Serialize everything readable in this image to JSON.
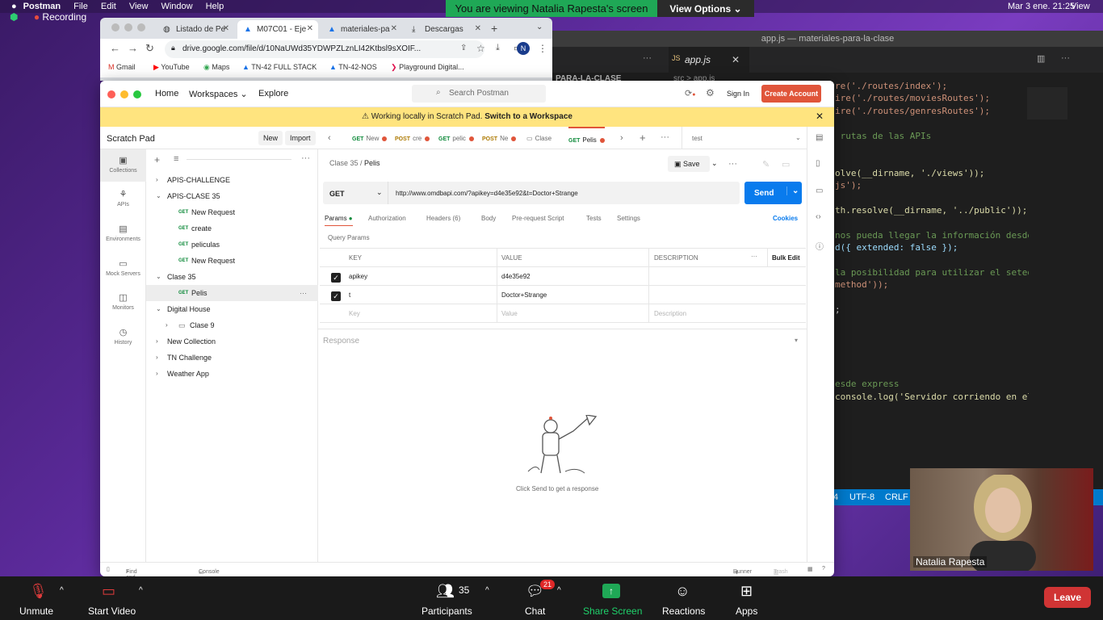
{
  "menubar": {
    "app": "Postman",
    "items": [
      "File",
      "Edit",
      "View",
      "Window",
      "Help"
    ],
    "recording": "Recording",
    "datetime": "Mar 3 ene.  21:25",
    "view": "View"
  },
  "zoom": {
    "banner": "You are viewing Natalia Rapesta's screen",
    "view_options": "View Options",
    "controls": {
      "unmute": "Unmute",
      "start_video": "Start Video",
      "participants": "Participants",
      "participants_count": "35",
      "chat": "Chat",
      "chat_badge": "21",
      "share": "Share Screen",
      "reactions": "Reactions",
      "apps": "Apps",
      "leave": "Leave"
    },
    "camera_name": "Natalia Rapesta"
  },
  "chrome": {
    "tabs": [
      "Listado de Pe",
      "M07C01 - Eje",
      "materiales-pa",
      "Descargas"
    ],
    "url": "drive.google.com/file/d/10NaUWd35YDWPZLznLI42Ktbsl9sXOIF...",
    "profile": "N",
    "bookmarks": [
      "Gmail",
      "YouTube",
      "Maps",
      "TN-42 FULL STACK",
      "TN-42-NOS",
      "Playground Digital..."
    ]
  },
  "vscode": {
    "title": "app.js — materiales-para-la-clase",
    "tab": "app.js",
    "explorer_label": "PARA-LA-CLASE",
    "path": "src > app.js",
    "code": [
      {
        "t": "re('./routes/index');",
        "k": "s"
      },
      {
        "t": "ire('./routes/moviesRoutes');",
        "k": "s"
      },
      {
        "t": "ire('./routes/genresRoutes');",
        "k": "s"
      },
      {
        "t": "",
        "k": ""
      },
      {
        "t": " rutas de las APIs",
        "k": "c"
      },
      {
        "t": "",
        "k": ""
      },
      {
        "t": "",
        "k": ""
      },
      {
        "t": "olve(__dirname, './views'));",
        "k": "f"
      },
      {
        "t": "js');",
        "k": "s"
      },
      {
        "t": "",
        "k": ""
      },
      {
        "t": "th.resolve(__dirname, '../public'));",
        "k": "f"
      },
      {
        "t": "",
        "k": ""
      },
      {
        "t": "nos pueda llegar la información desde",
        "k": "c"
      },
      {
        "t": "d({ extended: false });",
        "k": "v"
      },
      {
        "t": "",
        "k": ""
      },
      {
        "t": "la posibilidad para utilizar el seteo",
        "k": "c"
      },
      {
        "t": "method'));",
        "k": "s"
      },
      {
        "t": "",
        "k": ""
      },
      {
        "t": ";",
        "k": ""
      },
      {
        "t": "",
        "k": ""
      },
      {
        "t": "",
        "k": ""
      },
      {
        "t": "",
        "k": ""
      },
      {
        "t": "",
        "k": ""
      },
      {
        "t": "",
        "k": ""
      },
      {
        "t": "esde express",
        "k": "c"
      },
      {
        "t": "console.log('Servidor corriendo en el",
        "k": "f"
      }
    ],
    "status": {
      "line": "4",
      "encoding": "UTF-8",
      "eol": "CRLF"
    }
  },
  "postman": {
    "nav": {
      "home": "Home",
      "workspaces": "Workspaces",
      "explore": "Explore",
      "search": "Search Postman",
      "sign_in": "Sign In",
      "create_account": "Create Account"
    },
    "banner": {
      "text": "Working locally in Scratch Pad.",
      "link": "Switch to a Workspace"
    },
    "sidebar": {
      "title": "Scratch Pad",
      "new": "New",
      "import": "Import",
      "rail": [
        "Collections",
        "APIs",
        "Environments",
        "Mock Servers",
        "Monitors",
        "History"
      ],
      "tree": [
        {
          "label": "APIS-CHALLENGE",
          "level": 0,
          "chev": "›"
        },
        {
          "label": "APIS-CLASE 35",
          "level": 0,
          "chev": "⌄"
        },
        {
          "label": "New Request",
          "level": 1,
          "method": "GET"
        },
        {
          "label": "create",
          "level": 1,
          "method": "GET"
        },
        {
          "label": "peliculas",
          "level": 1,
          "method": "GET"
        },
        {
          "label": "New Request",
          "level": 1,
          "method": "GET"
        },
        {
          "label": "Clase 35",
          "level": 0,
          "chev": "⌄"
        },
        {
          "label": "Pelis",
          "level": 1,
          "method": "GET",
          "selected": true
        },
        {
          "label": "Digital House",
          "level": 0,
          "chev": "⌄"
        },
        {
          "label": "Clase 9",
          "level": 1,
          "chev": "›",
          "folder": true
        },
        {
          "label": "New Collection",
          "level": 0,
          "chev": "›"
        },
        {
          "label": "TN Challenge",
          "level": 0,
          "chev": "›"
        },
        {
          "label": "Weather App",
          "level": 0,
          "chev": "›"
        }
      ]
    },
    "tabs": [
      {
        "method": "GET",
        "label": "New"
      },
      {
        "method": "POST",
        "label": "cre"
      },
      {
        "method": "GET",
        "label": "pelic"
      },
      {
        "method": "POST",
        "label": "Ne"
      },
      {
        "method": "",
        "label": "Clase"
      },
      {
        "method": "GET",
        "label": "Pelis",
        "active": true
      }
    ],
    "environment": "test",
    "breadcrumb": {
      "parent": "Clase 35",
      "current": "Pelis"
    },
    "save": "Save",
    "request": {
      "method": "GET",
      "url": "http://www.omdbapi.com/?apikey=d4e35e92&t=Doctor+Strange",
      "send": "Send"
    },
    "req_tabs": [
      "Params",
      "Authorization",
      "Headers (6)",
      "Body",
      "Pre-request Script",
      "Tests",
      "Settings"
    ],
    "cookies": "Cookies",
    "query_params": "Query Params",
    "params_header": {
      "key": "KEY",
      "value": "VALUE",
      "description": "DESCRIPTION",
      "bulk": "Bulk Edit"
    },
    "params": [
      {
        "key": "apikey",
        "value": "d4e35e92"
      },
      {
        "key": "t",
        "value": "Doctor+Strange"
      }
    ],
    "placeholders": {
      "key": "Key",
      "value": "Value",
      "description": "Description"
    },
    "response": "Response",
    "empty": "Click Send to get a response",
    "footer": {
      "find": "Find and Replace",
      "console": "Console",
      "runner": "Runner",
      "trash": "Trash"
    }
  }
}
